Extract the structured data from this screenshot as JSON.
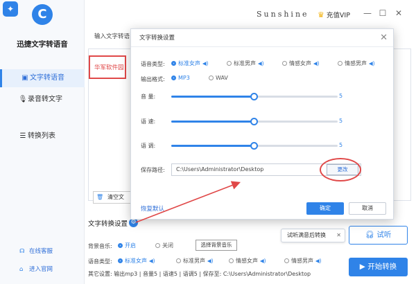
{
  "app": {
    "name": "迅捷文字转语音",
    "brand": "Sunshine",
    "vip_label": "充值VIP",
    "logo_glyph": "C",
    "colors": {
      "accent": "#2f83e8",
      "highlight": "#e04848"
    }
  },
  "sidebar": {
    "items": [
      {
        "label": "文字转语音",
        "icon": "text-icon"
      },
      {
        "label": "录音转文字",
        "icon": "microphone-icon"
      },
      {
        "label": "转换列表",
        "icon": "list-icon"
      }
    ],
    "footer": [
      {
        "label": "在线客服",
        "icon": "headset-icon"
      },
      {
        "label": "进入官网",
        "icon": "home-icon"
      }
    ]
  },
  "editor": {
    "tab_label": "输入文字转语",
    "content": "华军软件园",
    "clear_label": "清空文"
  },
  "settings": {
    "title": "文字转换设置",
    "bg_music_label": "背景音乐:",
    "bg_on": "开启",
    "bg_off": "关闭",
    "choose_music": "选择背景音乐",
    "voice_label": "语音类型:",
    "voices": [
      "标准女声",
      "标准男声",
      "情感女声",
      "情感男声"
    ],
    "info": "其它设置: 输出mp3 | 音量5 | 语速5 | 语调5 | 保存至: C:\\Users\\Administrator\\Desktop"
  },
  "actions": {
    "try_hint": "试听满意后转换",
    "try_listen": "试听",
    "start": "开始转换"
  },
  "dialog": {
    "title": "文字转换设置",
    "voice_type_label": "语音类型:",
    "voices": [
      "标准女声",
      "标准男声",
      "情感女声",
      "情感男声"
    ],
    "selected_voice": "标准女声",
    "format_label": "输出格式:",
    "formats": [
      "MP3",
      "WAV"
    ],
    "selected_format": "MP3",
    "volume": {
      "label": "音  量:",
      "value": "5",
      "level": 0.5
    },
    "speed": {
      "label": "语  速:",
      "value": "5",
      "level": 0.5
    },
    "pitch": {
      "label": "语  调:",
      "value": "5",
      "level": 0.5
    },
    "path_label": "保存路径:",
    "path": "C:\\Users\\Administrator\\Desktop",
    "change": "更改",
    "restore": "恢复默认",
    "ok": "确定",
    "cancel": "取消"
  }
}
